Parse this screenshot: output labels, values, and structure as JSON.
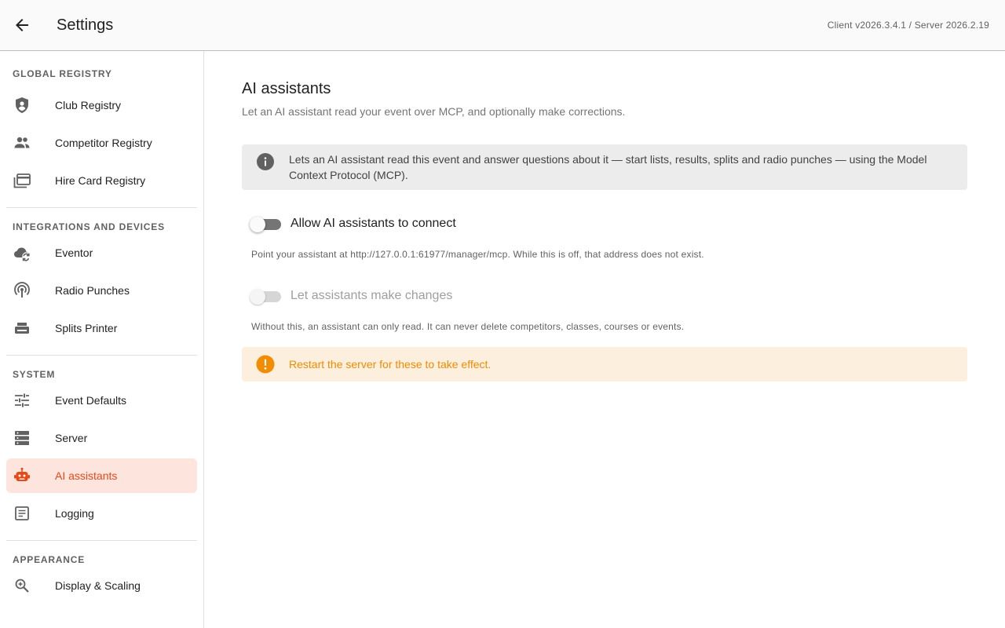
{
  "header": {
    "title": "Settings",
    "version": "Client v2026.3.4.1 / Server 2026.2.19",
    "back_icon": "arrow-left-icon"
  },
  "sidebar": {
    "sections": [
      {
        "title": "GLOBAL REGISTRY",
        "items": [
          {
            "label": "Club Registry",
            "icon": "shield-account-icon"
          },
          {
            "label": "Competitor Registry",
            "icon": "people-icon"
          },
          {
            "label": "Hire Card Registry",
            "icon": "cards-icon"
          }
        ]
      },
      {
        "title": "INTEGRATIONS AND DEVICES",
        "items": [
          {
            "label": "Eventor",
            "icon": "cloud-sync-icon"
          },
          {
            "label": "Radio Punches",
            "icon": "radio-tower-icon"
          },
          {
            "label": "Splits Printer",
            "icon": "printer-icon"
          }
        ]
      },
      {
        "title": "SYSTEM",
        "items": [
          {
            "label": "Event Defaults",
            "icon": "tune-icon"
          },
          {
            "label": "Server",
            "icon": "server-icon"
          },
          {
            "label": "AI assistants",
            "icon": "robot-icon",
            "active": true
          },
          {
            "label": "Logging",
            "icon": "document-icon"
          }
        ]
      },
      {
        "title": "APPEARANCE",
        "items": [
          {
            "label": "Display & Scaling",
            "icon": "zoom-in-icon"
          }
        ]
      }
    ]
  },
  "main": {
    "title": "AI assistants",
    "subtitle": "Let an AI assistant read your event over MCP, and optionally make corrections.",
    "info": "Lets an AI assistant read this event and answer questions about it — start lists, results, splits and radio punches — using the Model Context Protocol (MCP).",
    "toggle_connect": {
      "label": "Allow AI assistants to connect",
      "checked": false,
      "disabled": false,
      "helper": "Point your assistant at http://127.0.0.1:61977/manager/mcp. While this is off, that address does not exist."
    },
    "toggle_changes": {
      "label": "Let assistants make changes",
      "checked": false,
      "disabled": true,
      "helper": "Without this, an assistant can only read. It can never delete competitors, classes, courses or events."
    },
    "warning": "Restart the server for these to take effect."
  },
  "colors": {
    "accent": "#e64a19",
    "active_bg": "#fde4dd",
    "warning": "#ef8b00",
    "warning_bg": "#fdefde",
    "info_bg": "#ececec"
  }
}
